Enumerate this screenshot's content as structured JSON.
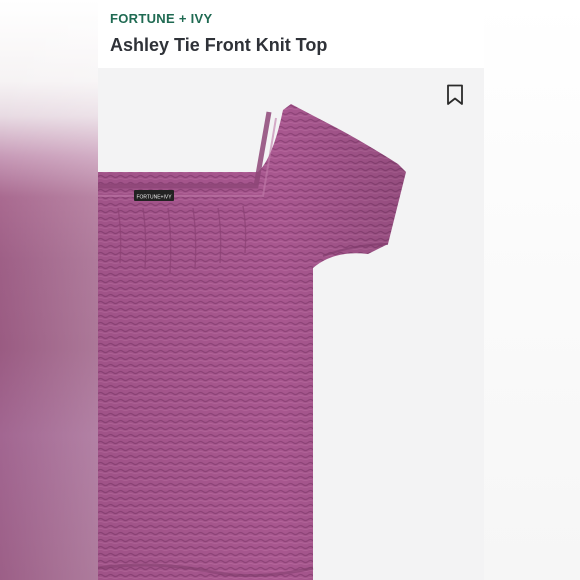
{
  "product": {
    "brand": "FORTUNE + IVY",
    "title": "Ashley Tie Front Knit Top",
    "label_tag": "FORTUNE+IVY",
    "color": "#a8578f"
  },
  "icons": {
    "bookmark": "bookmark-icon"
  }
}
